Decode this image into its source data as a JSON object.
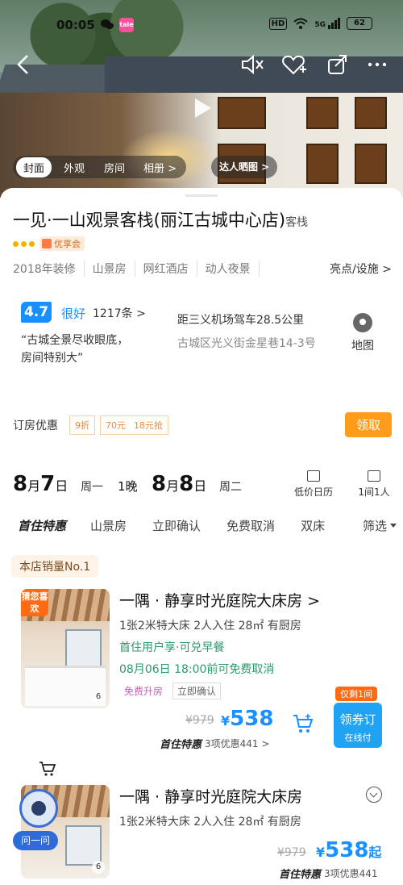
{
  "status_bar": {
    "time": "00:05",
    "app_badge": "tale",
    "battery": "62",
    "network": "5G",
    "hd": "HD"
  },
  "hero": {
    "tabs": [
      "封面",
      "外观",
      "房间"
    ],
    "album": "相册 >",
    "ugc": "达人晒图 >"
  },
  "hotel": {
    "name": "一见·一山观景客栈(丽江古城中心店)",
    "type_tag": "客栈",
    "member_tag": "优享会",
    "features": [
      "2018年装修",
      "山景房",
      "网红酒店",
      "动人夜景"
    ],
    "facilities_link": "亮点/设施 >",
    "score": "4.7",
    "score_label": "很好",
    "reviews": "1217条 >",
    "review_quote_line1": "“古城全景尽收眼底，",
    "review_quote_line2": "房间特别大”",
    "distance": "距三义机场驾车28.5公里",
    "address": "古城区光义街金星巷14-3号",
    "map_label": "地图"
  },
  "coupons": {
    "label": "订房优惠",
    "c1": "9折",
    "c2a": "70元",
    "c2b": "18元抢",
    "claim": "领取"
  },
  "dates": {
    "checkin_month": "8",
    "checkin_day": "7",
    "checkin_weekday": "周一",
    "nights": "1晚",
    "checkout_month": "8",
    "checkout_day": "8",
    "checkout_weekday": "周二",
    "calendar_label": "低价日历",
    "rooms_label": "1间1人",
    "month_unit": "月",
    "day_unit": "日"
  },
  "filters": {
    "items": [
      "首住特惠",
      "山景房",
      "立即确认",
      "免费取消",
      "双床"
    ],
    "screen": "筛选"
  },
  "bestseller": "本店销量No.1",
  "rooms": [
    {
      "name": "一隅 · 静享时光庭院大床房 >",
      "spec": "1张2米特大床  2人入住  28㎡  有厨房",
      "perk": "首住用户享·可兑早餐",
      "cancel": "08月06日  18:00前可免费取消",
      "tag1": "免费升房",
      "tag2": "立即确认",
      "old_price": "¥979",
      "price": "538",
      "currency": "¥",
      "special": "首住特惠",
      "special_extra": "3项优惠441 >",
      "limited": "仅剩1间",
      "book": "领券订",
      "book_sub": "在线付",
      "guess": "猜您喜欢",
      "photo_count": "6"
    },
    {
      "name": "一隅 · 静享时光庭院大床房",
      "spec": "1张2米特大床  2人入住  28㎡  有厨房",
      "old_price": "¥979",
      "price": "538",
      "currency": "¥",
      "suffix": "起",
      "special": "首住特惠",
      "special_extra": "3项优惠441",
      "photo_count": "6",
      "ask": "问一问"
    }
  ],
  "colors": {
    "accent": "#1890ff",
    "orange": "#ff9c1a",
    "green": "#2a9a6a"
  }
}
